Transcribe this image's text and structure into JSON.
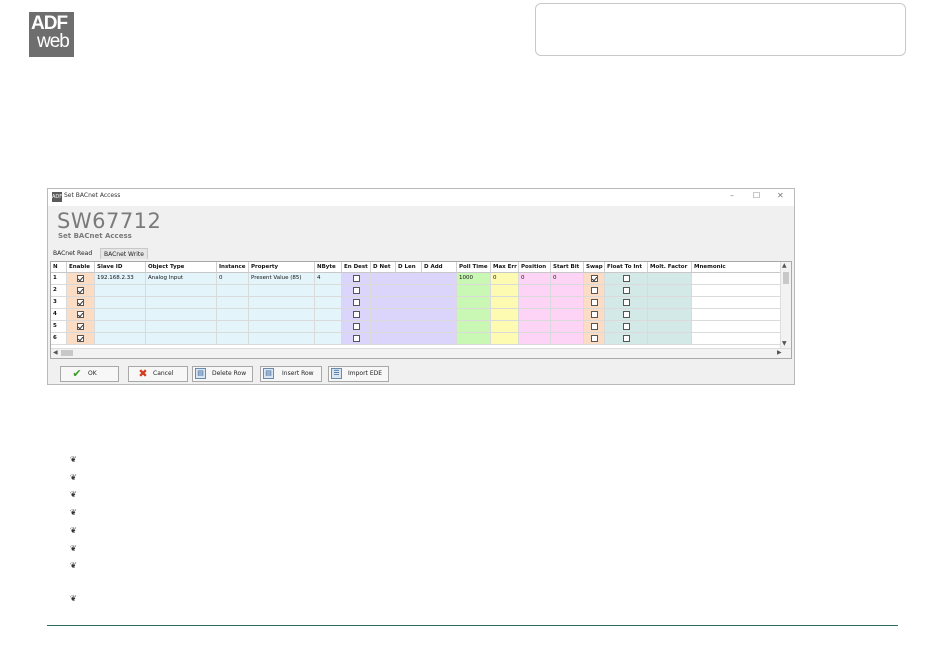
{
  "logo": {
    "line1": "ADF",
    "line2": "web"
  },
  "window": {
    "title": "Set BACnet Access",
    "icon_text": "ADF",
    "controls": [
      "–",
      "☐",
      "✕"
    ],
    "heading": "SW67712",
    "subheading": "Set BACnet Access"
  },
  "tabs": [
    {
      "label": "BACnet Read",
      "active": true
    },
    {
      "label": "BACnet Write",
      "active": false
    }
  ],
  "columns": [
    "N",
    "Enable",
    "Slave ID",
    "Object Type",
    "Instance",
    "Property",
    "NByte",
    "En Dest",
    "D Net",
    "D Len",
    "D Add",
    "Poll Time",
    "Max Err",
    "Position",
    "Start Bit",
    "Swap",
    "Float To Int",
    "Molt. Factor",
    "Mnemonic"
  ],
  "column_colors": {
    "enable": "#fbdcc4",
    "blue": "#e3f4fb",
    "lavender": "#dcd5fb",
    "green": "#c9f7b4",
    "yellow": "#fdfbb2",
    "pink": "#fdd4f6",
    "swap": "#fbdcc4",
    "teal": "#d3e9e8"
  },
  "rows": [
    {
      "n": "1",
      "enable": true,
      "slave_id": "192.168.2.33",
      "object_type": "Analog Input",
      "instance": "0",
      "property": "Present Value (85)",
      "nbyte": "4",
      "en_dest": false,
      "d_net": "",
      "d_len": "",
      "d_add": "",
      "poll_time": "1000",
      "max_err": "0",
      "position": "0",
      "start_bit": "0",
      "swap": true,
      "float_to_int": false,
      "molt_factor": "",
      "mnemonic": ""
    },
    {
      "n": "2",
      "enable": true,
      "slave_id": "",
      "object_type": "",
      "instance": "",
      "property": "",
      "nbyte": "",
      "en_dest": false,
      "d_net": "",
      "d_len": "",
      "d_add": "",
      "poll_time": "",
      "max_err": "",
      "position": "",
      "start_bit": "",
      "swap": false,
      "float_to_int": false,
      "molt_factor": "",
      "mnemonic": ""
    },
    {
      "n": "3",
      "enable": true,
      "slave_id": "",
      "object_type": "",
      "instance": "",
      "property": "",
      "nbyte": "",
      "en_dest": false,
      "d_net": "",
      "d_len": "",
      "d_add": "",
      "poll_time": "",
      "max_err": "",
      "position": "",
      "start_bit": "",
      "swap": false,
      "float_to_int": false,
      "molt_factor": "",
      "mnemonic": ""
    },
    {
      "n": "4",
      "enable": true,
      "slave_id": "",
      "object_type": "",
      "instance": "",
      "property": "",
      "nbyte": "",
      "en_dest": false,
      "d_net": "",
      "d_len": "",
      "d_add": "",
      "poll_time": "",
      "max_err": "",
      "position": "",
      "start_bit": "",
      "swap": false,
      "float_to_int": false,
      "molt_factor": "",
      "mnemonic": ""
    },
    {
      "n": "5",
      "enable": true,
      "slave_id": "",
      "object_type": "",
      "instance": "",
      "property": "",
      "nbyte": "",
      "en_dest": false,
      "d_net": "",
      "d_len": "",
      "d_add": "",
      "poll_time": "",
      "max_err": "",
      "position": "",
      "start_bit": "",
      "swap": false,
      "float_to_int": false,
      "molt_factor": "",
      "mnemonic": ""
    },
    {
      "n": "6",
      "enable": true,
      "slave_id": "",
      "object_type": "",
      "instance": "",
      "property": "",
      "nbyte": "",
      "en_dest": false,
      "d_net": "",
      "d_len": "",
      "d_add": "",
      "poll_time": "",
      "max_err": "",
      "position": "",
      "start_bit": "",
      "swap": false,
      "float_to_int": false,
      "molt_factor": "",
      "mnemonic": ""
    }
  ],
  "buttons": {
    "ok": "OK",
    "cancel": "Cancel",
    "delete_row": "Delete Row",
    "insert_row": "Insert Row",
    "import_ede": "Import EDE"
  },
  "bullet_glyph": "❦"
}
